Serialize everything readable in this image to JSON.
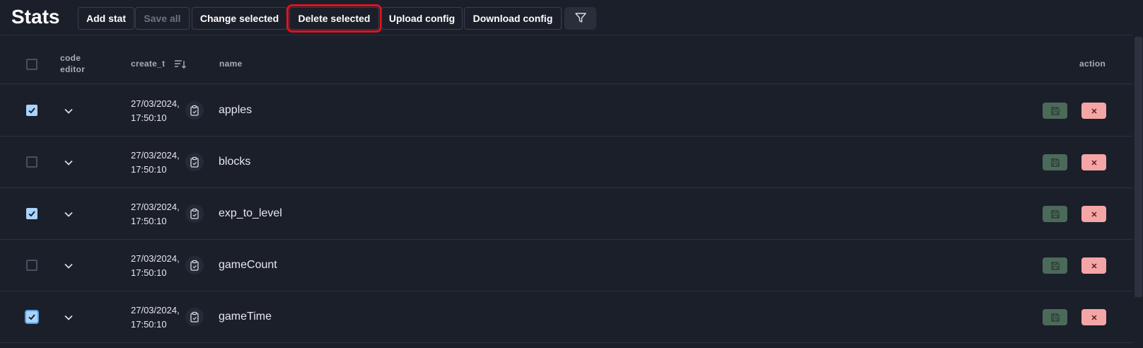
{
  "header": {
    "title": "Stats",
    "buttons": {
      "add_stat": "Add stat",
      "save_all": "Save all",
      "change_selected": "Change selected",
      "delete_selected": "Delete selected",
      "upload_config": "Upload config",
      "download_config": "Download config"
    },
    "filter_icon": "filter-icon"
  },
  "table": {
    "columns": {
      "code_editor_1": "code",
      "code_editor_2": "editor",
      "create_t": "create_t",
      "name": "name",
      "action": "action"
    },
    "rows": [
      {
        "checked": true,
        "date": "27/03/2024,",
        "time": "17:50:10",
        "name": "apples"
      },
      {
        "checked": false,
        "date": "27/03/2024,",
        "time": "17:50:10",
        "name": "blocks"
      },
      {
        "checked": true,
        "date": "27/03/2024,",
        "time": "17:50:10",
        "name": "exp_to_level"
      },
      {
        "checked": false,
        "date": "27/03/2024,",
        "time": "17:50:10",
        "name": "gameCount"
      },
      {
        "checked": true,
        "date": "27/03/2024,",
        "time": "17:50:10",
        "name": "gameTime"
      }
    ]
  },
  "colors": {
    "background": "#1b1f2a",
    "checkbox_checked": "#a8d4ff",
    "save_button": "#4b6a5a",
    "delete_button": "#f4a5a5",
    "highlight": "#e0141e"
  }
}
